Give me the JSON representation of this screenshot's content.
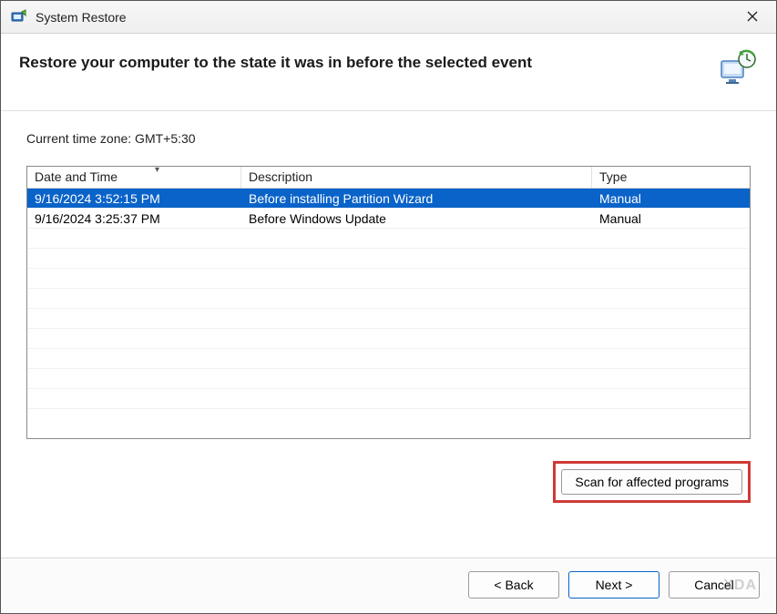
{
  "window": {
    "title": "System Restore"
  },
  "header": {
    "heading": "Restore your computer to the state it was in before the selected event"
  },
  "timezone_label": "Current time zone: GMT+5:30",
  "table": {
    "columns": {
      "datetime": "Date and Time",
      "description": "Description",
      "type": "Type"
    },
    "rows": [
      {
        "datetime": "9/16/2024 3:52:15 PM",
        "description": "Before installing Partition Wizard",
        "type": "Manual",
        "selected": true
      },
      {
        "datetime": "9/16/2024 3:25:37 PM",
        "description": "Before Windows Update",
        "type": "Manual",
        "selected": false
      }
    ]
  },
  "buttons": {
    "scan": "Scan for affected programs",
    "back": "< Back",
    "next": "Next >",
    "cancel": "Cancel"
  },
  "watermark": "XDA"
}
